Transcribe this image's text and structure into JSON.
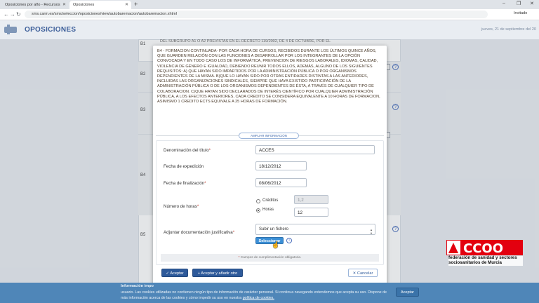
{
  "browser": {
    "tabs": [
      {
        "label": "Oposiciones por año - Recursos"
      },
      {
        "label": "Oposiciones"
      }
    ],
    "url": "sms.carm.es/sms/seleccion/oposiciones/view/autobaremacion/autobaremacion.xhtml",
    "profile": "Invitado"
  },
  "app": {
    "title": "OPOSICIONES",
    "date": "jueves, 21 de septiembre del 20"
  },
  "background": {
    "top_text": "DEL SUBGRUPO A1 O A2 PREVISTAS EN EL DECRETO 119/2002, DE 4 DE OCTUBRE, POR EL",
    "rows": [
      "B1",
      "B2",
      "B3",
      "B4",
      "B5"
    ]
  },
  "modal": {
    "description": "B4 - FORMACION CONTINUADA- POR CADA HORA DE CURSOS, RECIBIDOS DURANTE LOS ÚLTIMOS QUINCE AÑOS, QUE GUARDEN RELACIÓN CON LAS FUNCIONES A DESARROLLAR POR LOS INTEGRANTES DE LA OPCIÓN CONVOCADA Y EN TODO CASO LOS DE INFORMÁTICA, PREVENCION DE RIESGOS LABORALES, IDIOMAS, CALIDAD, VIOLENCIA DE GÉNERO E IGUALDAD, DEBIENDO REUNIR TODOS ELLOS, ADEMÁS, ALGUNO DE LOS SIGUIENTES REQUISITOS: A) QUE HAYAN SIDO IMPARTIDOS POR LA ADMINISTRACIÓN PÚBLICA O POR ORGANISMOS DEPENDIENTES DE LA MISMA. B)QUE LO HAYAN SIDO POR OTRAS ENTIDADES DISTINTAS A LAS ANTERIORES, INCLUIDAS LAS ORGANIZACIONES SINDICALES, SIEMPRE QUE HAYA EXISTIDO PARTICIPACIÓN DE LA ADMINISTRACIÓN PÚBLICA O DE LOS ORGANISMOS DEPENDIENTES DE ÉSTA, A TRAVÉS DE CUALQUIER TIPO DE COLABORACION. C)QUE HAYAN SIDO DECLARADOS DE INTERÉS CIENTÍFICO POR CUALQUIER ADMINISTRACIÓN PÚBLICA, A LOS EFECTOS ANTERIORES, CADA CREDITO SE CONSIDERA EQUIVALENTE A 10 HORAS DE FORMACION, ASIMISMO 1 CREDITO ECTS EQUIVALE A 25 HORAS DE FORMACIÓN.",
    "ampliar_label": "AMPLIAR INFORMACIÓN",
    "fields": {
      "titulo_label": "Denominación del título",
      "titulo_value": "ACCES",
      "expedicion_label": "Fecha de expedición",
      "expedicion_value": "18/12/2012",
      "finalizacion_label": "Fecha de finalización",
      "finalizacion_value": "08/06/2012",
      "horas_label": "Número de horas",
      "creditos_label": "Créditos",
      "creditos_value": "1,2",
      "horas_option_label": "Horas",
      "horas_value": "12",
      "doc_label": "Adjuntar documentación justificativa",
      "doc_placeholder": "Subir un fichero",
      "select_button": "Seleccionar",
      "required_star": "*"
    },
    "notice": "Campos de cumplimentación obligatoria.",
    "buttons": {
      "accept": "Aceptar",
      "accept_add": "Aceptar y añadir otro",
      "cancel": "Cancelar"
    }
  },
  "cookie": {
    "title": "Información impo",
    "text": "usuario. Las cookies utilizadas no contienen ningún tipo de información de carácter personal. Si continua navegando entendemos que acepta su uso. Dispone de más información acerca de las cookies y cómo impedir su uso en nuestra",
    "link": "política de cookies.",
    "accept": "Aceptar"
  },
  "watermark": {
    "brand": "CCOO",
    "line1": "federación de sanidad y sectores",
    "line2": "sociosanitarios de Murcia"
  },
  "colors": {
    "primary": "#2e5a9a",
    "header_title": "#3d5f9a",
    "select_btn": "#3b8fd6",
    "cookie_bg": "#4f86b8",
    "ccoo_red": "#e3000f"
  }
}
